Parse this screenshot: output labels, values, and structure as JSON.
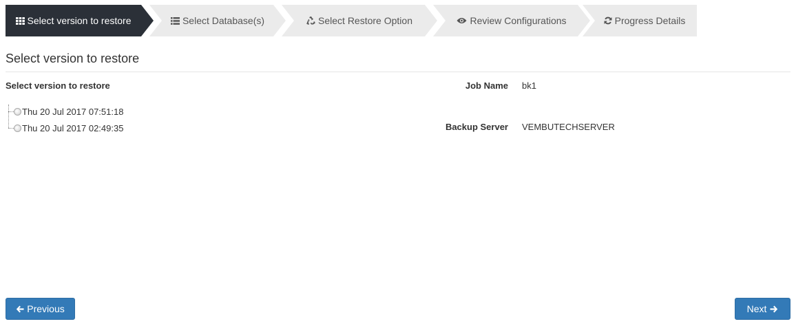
{
  "wizard": {
    "steps": [
      {
        "label": "Select version to restore",
        "icon": "grid-icon",
        "active": true
      },
      {
        "label": "Select Database(s)",
        "icon": "list-icon",
        "active": false
      },
      {
        "label": "Select Restore Option",
        "icon": "recycle-icon",
        "active": false
      },
      {
        "label": "Review Configurations",
        "icon": "eye-icon",
        "active": false
      },
      {
        "label": "Progress Details",
        "icon": "refresh-icon",
        "active": false
      }
    ]
  },
  "page": {
    "title": "Select version to restore"
  },
  "versions": {
    "heading": "Select version to restore",
    "items": [
      {
        "label": "Thu 20 Jul 2017 07:51:18",
        "selected": false
      },
      {
        "label": "Thu 20 Jul 2017 02:49:35",
        "selected": false
      }
    ]
  },
  "details": {
    "job_name_label": "Job Name",
    "job_name_value": "bk1",
    "backup_server_label": "Backup Server",
    "backup_server_value": "VEMBUTECHSERVER"
  },
  "buttons": {
    "previous": "Previous",
    "next": "Next"
  },
  "colors": {
    "active_step_bg": "#2b3038",
    "inactive_step_bg": "#ebebeb",
    "button_primary": "#337ab7"
  }
}
